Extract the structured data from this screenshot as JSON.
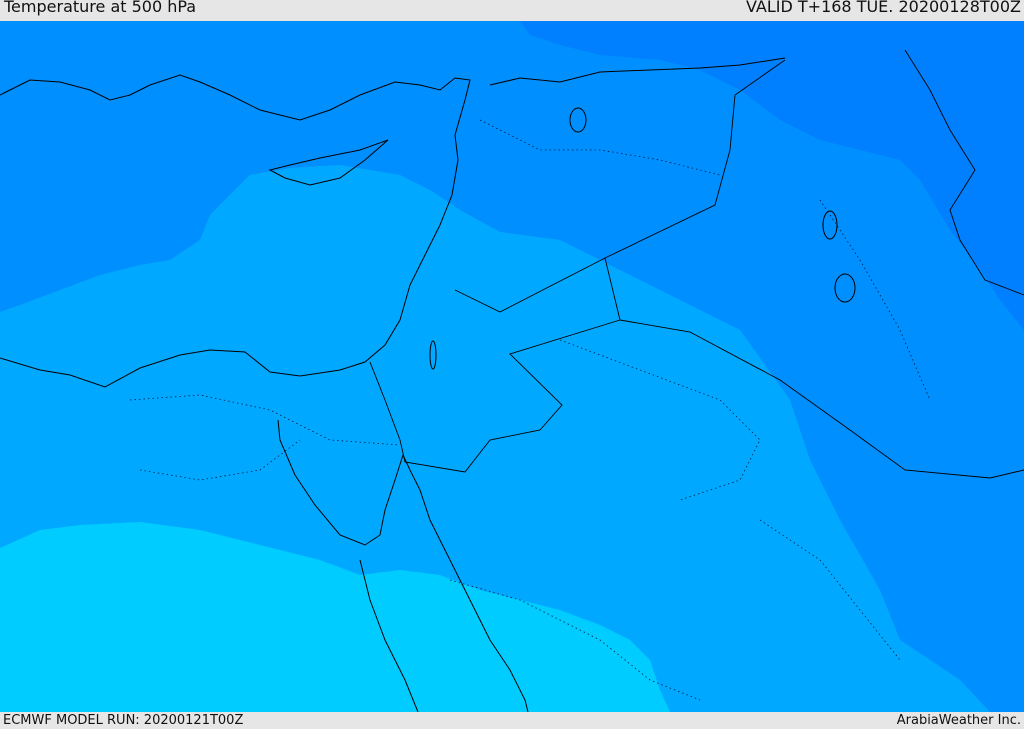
{
  "header": {
    "title": "Temperature at 500 hPa",
    "valid": "VALID T+168 TUE. 20200128T00Z"
  },
  "footer": {
    "model_run": "ECMWF MODEL RUN: 20200121T00Z",
    "credit": "ArabiaWeather Inc."
  },
  "colors": {
    "coldest": "#0080ff",
    "cold": "#008fff",
    "mid": "#009bff",
    "mild": "#00a9ff",
    "warm": "#00ccff",
    "coastline": "#000000"
  }
}
